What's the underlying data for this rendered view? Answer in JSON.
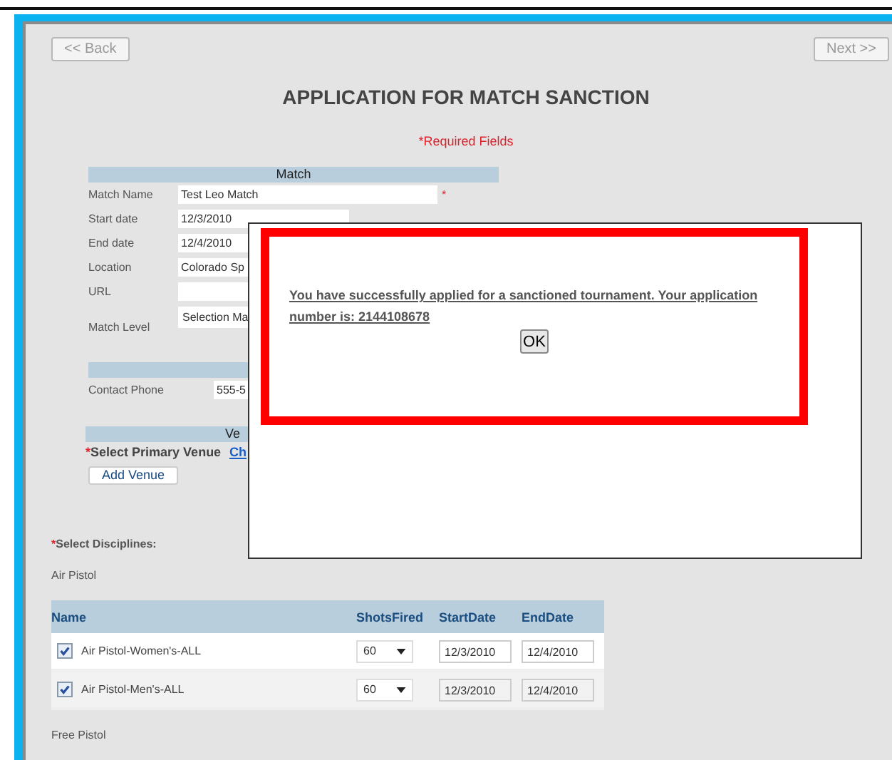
{
  "nav": {
    "back": "<< Back",
    "next": "Next >>"
  },
  "title": "APPLICATION FOR MATCH SANCTION",
  "required_note": "*Required Fields",
  "match_section": {
    "header": "Match",
    "fields": [
      {
        "label": "Match Name",
        "value": "Test Leo Match",
        "required_mark": "*",
        "kind": "text"
      },
      {
        "label": "Start date",
        "value": "12/3/2010",
        "kind": "text"
      },
      {
        "label": "End date",
        "value": "12/4/2010",
        "kind": "text"
      },
      {
        "label": "Location",
        "value": "Colorado Sp",
        "kind": "text"
      },
      {
        "label": "URL",
        "kind": "text"
      },
      {
        "label": "Match Level",
        "value": "Selection Ma",
        "kind": "select"
      }
    ]
  },
  "contact_section": {
    "fields": [
      {
        "label": "Contact Phone",
        "value": "555-5"
      }
    ]
  },
  "venue_section": {
    "header": "Ve",
    "required_mark": "*",
    "label": "Select Primary Venue",
    "link": "Ch",
    "button": "Add Venue"
  },
  "disciplines": {
    "required_mark": "*",
    "label": "Select Disciplines:",
    "groups": [
      {
        "name": "Air Pistol",
        "columns": [
          "Name",
          "ShotsFired",
          "StartDate",
          "EndDate"
        ],
        "rows": [
          {
            "name": "Air Pistol-Women's-ALL",
            "checked": true,
            "shots": "60",
            "start": "12/3/2010",
            "end": "12/4/2010"
          },
          {
            "name": "Air Pistol-Men's-ALL",
            "checked": true,
            "shots": "60",
            "start": "12/3/2010",
            "end": "12/4/2010"
          }
        ]
      },
      {
        "name": "Free Pistol"
      }
    ]
  },
  "dialog": {
    "message": "You have successfully applied for a sanctioned tournament. Your application number is: 2144108678",
    "button": "OK"
  }
}
